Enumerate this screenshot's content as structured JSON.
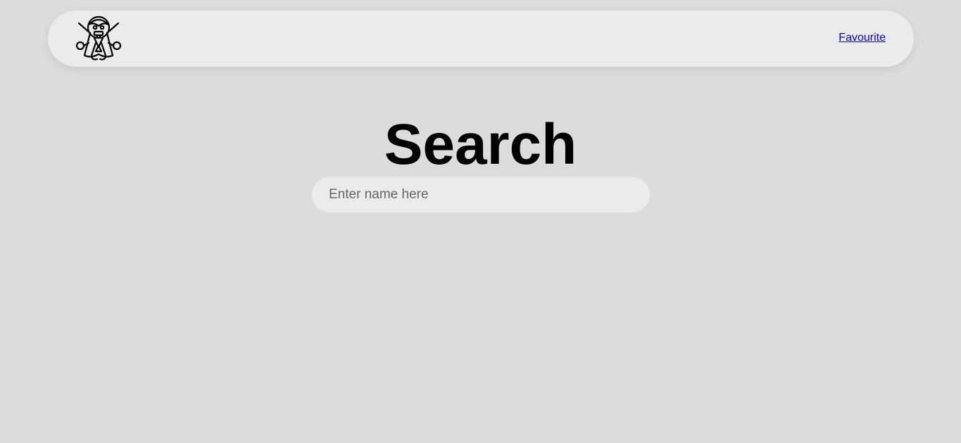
{
  "navbar": {
    "logo_icon": "vampire-dracula-icon",
    "favourite_label": "Favourite"
  },
  "main": {
    "title": "Search",
    "search": {
      "value": "",
      "placeholder": "Enter name here"
    }
  },
  "colors": {
    "background": "#dcdcdc",
    "surface": "#ebebeb",
    "link": "#0000ee",
    "text": "#000000"
  }
}
